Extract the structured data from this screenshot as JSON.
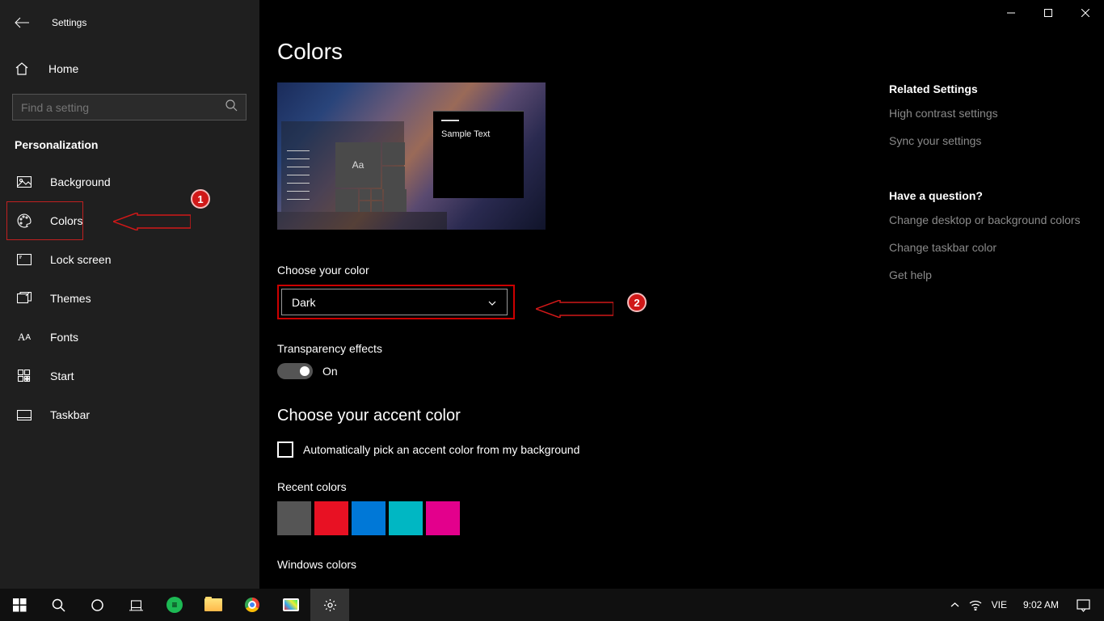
{
  "window": {
    "title": "Settings"
  },
  "sidebar": {
    "home": "Home",
    "search_placeholder": "Find a setting",
    "section": "Personalization",
    "items": [
      {
        "label": "Background"
      },
      {
        "label": "Colors"
      },
      {
        "label": "Lock screen"
      },
      {
        "label": "Themes"
      },
      {
        "label": "Fonts"
      },
      {
        "label": "Start"
      },
      {
        "label": "Taskbar"
      }
    ]
  },
  "main": {
    "title": "Colors",
    "preview_sample_text": "Sample Text",
    "preview_aa": "Aa",
    "choose_color_label": "Choose your color",
    "choose_color_value": "Dark",
    "transparency_label": "Transparency effects",
    "transparency_state": "On",
    "accent_heading": "Choose your accent color",
    "auto_pick_label": "Automatically pick an accent color from my background",
    "recent_label": "Recent colors",
    "recent_colors": [
      "#555555",
      "#e81123",
      "#0078d7",
      "#00b7c3",
      "#e3008c"
    ],
    "windows_colors_label": "Windows colors"
  },
  "rail": {
    "related_title": "Related Settings",
    "links1": [
      "High contrast settings",
      "Sync your settings"
    ],
    "question_title": "Have a question?",
    "links2": [
      "Change desktop or background colors",
      "Change taskbar color",
      "Get help"
    ]
  },
  "annotations": {
    "b1": "1",
    "b2": "2"
  },
  "taskbar": {
    "ime": "VIE",
    "time": "9:02 AM"
  }
}
